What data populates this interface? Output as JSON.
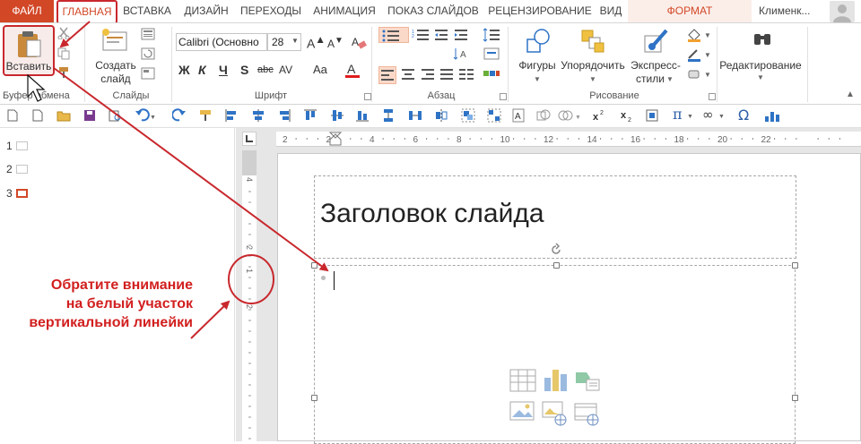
{
  "tabs": {
    "file": "ФАЙЛ",
    "home": "ГЛАВНАЯ",
    "insert": "ВСТАВКА",
    "design": "ДИЗАЙН",
    "transitions": "ПЕРЕХОДЫ",
    "animation": "АНИМАЦИЯ",
    "slideshow": "ПОКАЗ СЛАЙДОВ",
    "review": "РЕЦЕНЗИРОВАНИЕ",
    "view": "ВИД",
    "format": "ФОРМАТ"
  },
  "user": {
    "name": "Клименк..."
  },
  "ribbon": {
    "paste_label": "Вставить",
    "new_slide_label_1": "Создать",
    "new_slide_label_2": "слайд",
    "font_name": "Calibri (Основно",
    "font_size": "28",
    "shapes_label": "Фигуры",
    "arrange_label": "Упорядочить",
    "styles_label_1": "Экспресс-",
    "styles_label_2": "стили",
    "editing_label": "Редактирование",
    "bold": "Ж",
    "italic": "К",
    "underline": "Ч",
    "strike": "S",
    "spacing": "abc",
    "case": "AV",
    "groups": {
      "clipboard": "Буфер обмена",
      "slides": "Слайды",
      "font": "Шрифт",
      "paragraph": "Абзац",
      "drawing": "Рисование"
    }
  },
  "ruler": {
    "h_ticks": [
      "2",
      "2",
      "4",
      "6",
      "8",
      "10",
      "12",
      "14",
      "16",
      "18",
      "20",
      "22"
    ],
    "v_ticks": [
      "4",
      "2",
      "1",
      "2"
    ]
  },
  "slides_panel": {
    "numbers": [
      "1",
      "2",
      "3"
    ]
  },
  "slide": {
    "title": "Заголовок слайда"
  },
  "annotation": {
    "line1": "Обратите внимание",
    "line2": "на белый участок",
    "line3": "вертикальной линейки"
  },
  "colors": {
    "accent": "#d24726",
    "annotation": "#d21f1f",
    "highlight_border": "#c8282d"
  }
}
